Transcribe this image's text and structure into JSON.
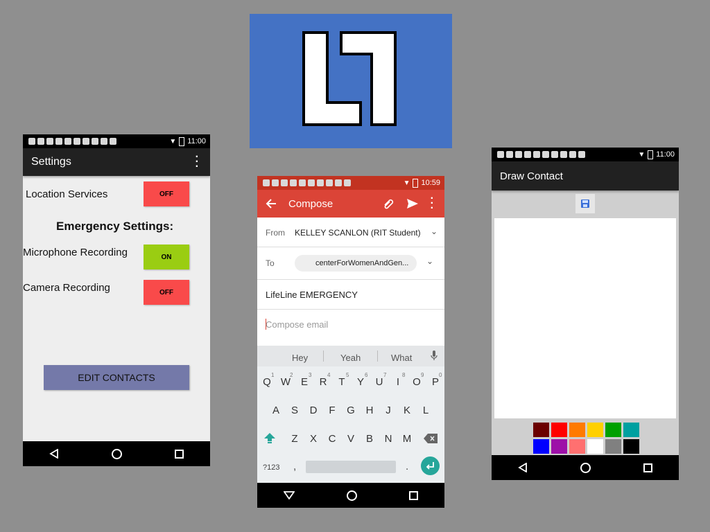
{
  "logo": {
    "letters": "L7",
    "bg_color": "#4472c4"
  },
  "settings_phone": {
    "status_time": "11:00",
    "title": "Settings",
    "location_label": "Location Services",
    "location_state": "OFF",
    "section_heading": "Emergency Settings:",
    "mic_label": "Microphone Recording",
    "mic_state": "ON",
    "camera_label": "Camera Recording",
    "camera_state": "OFF",
    "edit_contacts_label": "EDIT CONTACTS",
    "colors": {
      "off": "#f94a4a",
      "on": "#9acd12",
      "button": "#7479a9",
      "toolbar": "#212121"
    }
  },
  "compose_phone": {
    "status_time": "10:59",
    "title": "Compose",
    "from_label": "From",
    "from_value": "KELLEY SCANLON (RIT Student)",
    "to_label": "To",
    "to_chip": "centerForWomenAndGen...",
    "subject": "LifeLine EMERGENCY",
    "body_placeholder": "Compose email",
    "suggestions": [
      "Hey",
      "Yeah",
      "What"
    ],
    "keyboard": {
      "row1": [
        "Q",
        "W",
        "E",
        "R",
        "T",
        "Y",
        "U",
        "I",
        "O",
        "P"
      ],
      "row1_numbers": [
        "1",
        "2",
        "3",
        "4",
        "5",
        "6",
        "7",
        "8",
        "9",
        "0"
      ],
      "row2": [
        "A",
        "S",
        "D",
        "F",
        "G",
        "H",
        "J",
        "K",
        "L"
      ],
      "row3": [
        "Z",
        "X",
        "C",
        "V",
        "B",
        "N",
        "M"
      ],
      "symbols_key": "?123",
      "comma": ",",
      "period": "."
    },
    "colors": {
      "toolbar": "#db4437",
      "status": "#c23321",
      "enter": "#26a69a"
    }
  },
  "draw_phone": {
    "status_time": "11:00",
    "title": "Draw Contact",
    "palette": [
      "#6b0000",
      "#ff0000",
      "#ff7a00",
      "#ffd000",
      "#00a000",
      "#00a0a0",
      "#0000ff",
      "#9d10a8",
      "#ff7070",
      "#ffffff",
      "#808080",
      "#000000"
    ]
  }
}
